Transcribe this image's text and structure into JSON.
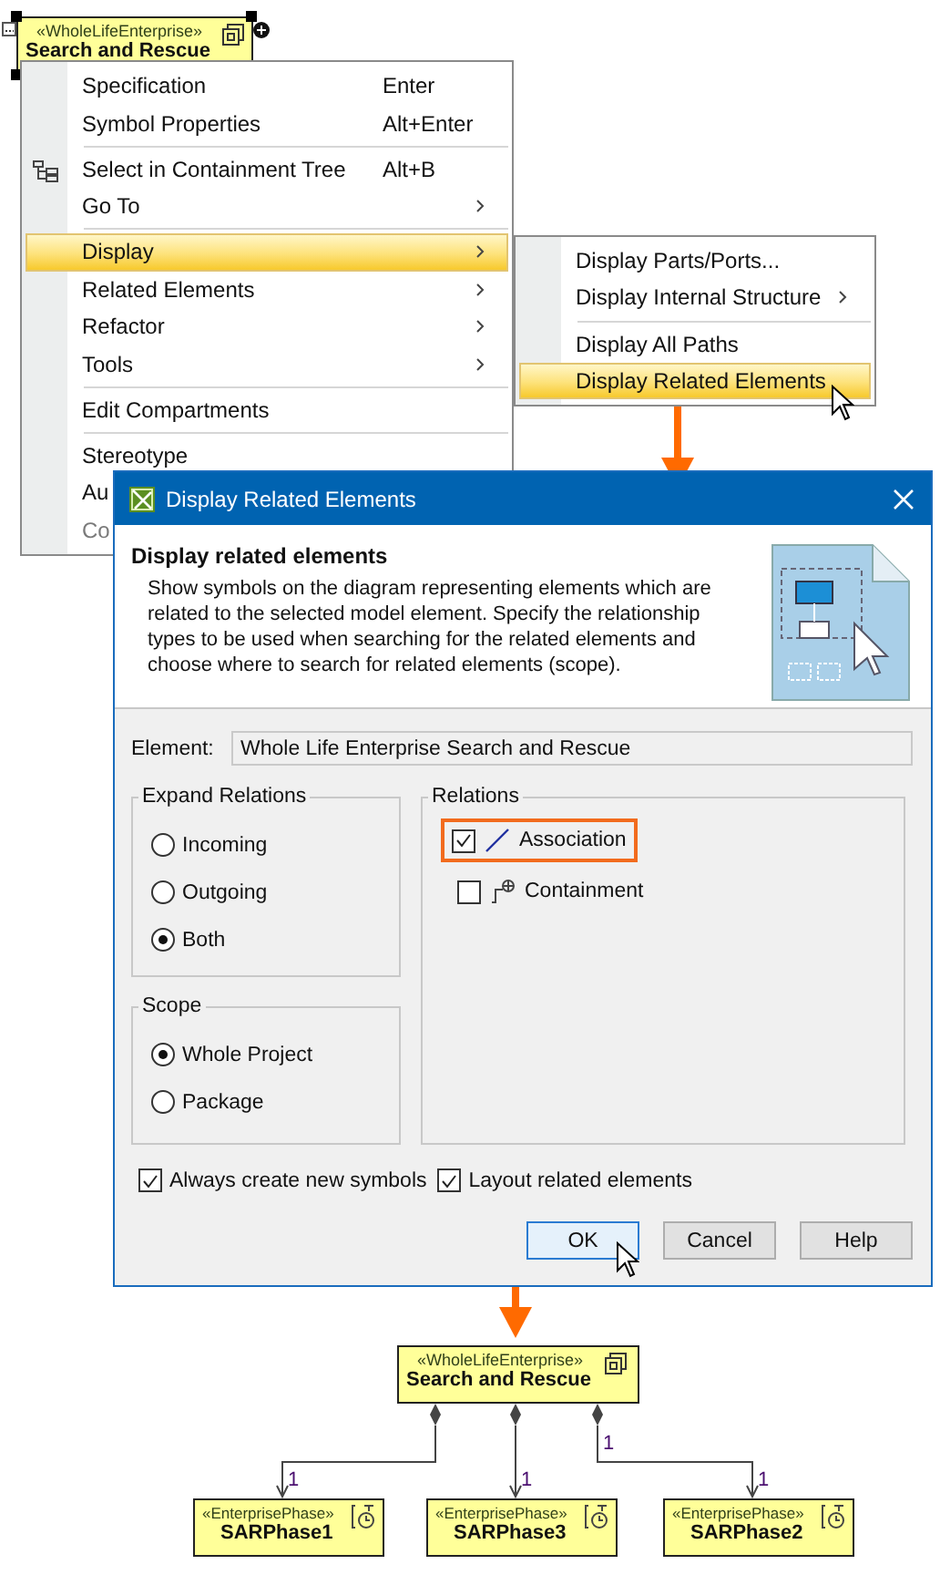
{
  "source_node": {
    "stereotype": "«WholeLifeEnterprise»",
    "name": "Search and Rescue",
    "selected": true
  },
  "context_menu": {
    "sections": [
      [
        {
          "label": "Specification",
          "shortcut": "Enter",
          "has_submenu": false,
          "selected": false,
          "disabled": false,
          "has_icon": false
        },
        {
          "label": "Symbol Properties",
          "shortcut": "Alt+Enter",
          "has_submenu": false,
          "selected": false,
          "disabled": false,
          "has_icon": false
        }
      ],
      [
        {
          "label": "Select in Containment Tree",
          "shortcut": "Alt+B",
          "has_submenu": false,
          "selected": false,
          "disabled": false,
          "has_icon": true
        },
        {
          "label": "Go To",
          "has_submenu": true,
          "selected": false,
          "disabled": false,
          "has_icon": false
        }
      ],
      [
        {
          "label": "Display",
          "has_submenu": true,
          "selected": true,
          "disabled": false,
          "has_icon": false
        },
        {
          "label": "Related Elements",
          "has_submenu": true,
          "selected": false,
          "disabled": false,
          "has_icon": false
        },
        {
          "label": "Refactor",
          "has_submenu": true,
          "selected": false,
          "disabled": false,
          "has_icon": false
        },
        {
          "label": "Tools",
          "has_submenu": true,
          "selected": false,
          "disabled": false,
          "has_icon": false
        }
      ],
      [
        {
          "label": "Edit Compartments",
          "has_submenu": false,
          "selected": false,
          "disabled": false,
          "has_icon": false
        }
      ],
      [
        {
          "label": "Stereotype",
          "has_submenu": false,
          "selected": false,
          "disabled": false,
          "has_icon": false
        },
        {
          "label": "Au",
          "selected": false,
          "disabled": false,
          "has_icon": false
        },
        {
          "label": "Co",
          "selected": false,
          "disabled": true,
          "has_icon": false
        }
      ]
    ]
  },
  "submenu": {
    "sections": [
      [
        {
          "label": "Display Parts/Ports...",
          "has_submenu": false,
          "selected": false
        },
        {
          "label": "Display Internal Structure",
          "has_submenu": true,
          "selected": false
        }
      ],
      [
        {
          "label": "Display All Paths",
          "has_submenu": false,
          "selected": false
        },
        {
          "label": "Display Related Elements",
          "has_submenu": false,
          "selected": true
        }
      ]
    ]
  },
  "dialog": {
    "title": "Display Related Elements",
    "heading": "Display related elements",
    "description": "Show symbols on the diagram representing elements which are related to the selected model element. Specify the relationship types to be used when searching for the related elements and choose where to search for related elements (scope).",
    "element_label": "Element:",
    "element_value": "Whole Life Enterprise Search and Rescue",
    "expand_relations": {
      "title": "Expand Relations",
      "options": [
        {
          "label": "Incoming",
          "selected": false
        },
        {
          "label": "Outgoing",
          "selected": false
        },
        {
          "label": "Both",
          "selected": true
        }
      ]
    },
    "scope": {
      "title": "Scope",
      "options": [
        {
          "label": "Whole Project",
          "selected": true
        },
        {
          "label": "Package",
          "selected": false
        }
      ]
    },
    "relations": {
      "title": "Relations",
      "items": [
        {
          "kind": "association",
          "label": "Association",
          "checked": true,
          "highlighted": true
        },
        {
          "kind": "containment",
          "label": "Containment",
          "checked": false,
          "highlighted": false
        }
      ]
    },
    "options": [
      {
        "label": "Always create new symbols",
        "checked": true
      },
      {
        "label": "Layout related elements",
        "checked": true
      }
    ],
    "buttons": [
      {
        "label": "OK",
        "focused": true
      },
      {
        "label": "Cancel",
        "focused": false
      },
      {
        "label": "Help",
        "focused": false
      }
    ]
  },
  "result_diagram": {
    "parent": {
      "stereotype": "«WholeLifeEnterprise»",
      "name": "Search and Rescue"
    },
    "children": [
      {
        "stereotype": "«EnterprisePhase»",
        "name": "SARPhase1",
        "target_label": "1"
      },
      {
        "stereotype": "«EnterprisePhase»",
        "name": "SARPhase3",
        "target_label": "1"
      },
      {
        "stereotype": "«EnterprisePhase»",
        "name": "SARPhase2",
        "target_label": "1",
        "source_label": "1"
      }
    ]
  }
}
